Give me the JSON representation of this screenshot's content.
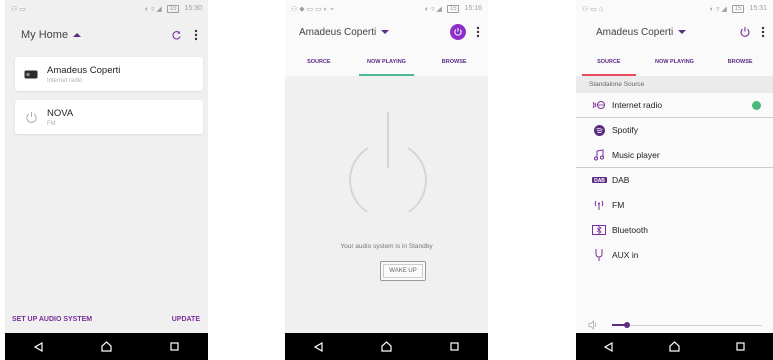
{
  "status_bar": {
    "p1_time": "15:30",
    "p2_time": "15:16",
    "p3_time": "15:31",
    "battery": "15"
  },
  "home": {
    "title": "My Home",
    "devices": [
      {
        "name": "Amadeus Coperti",
        "subtitle": "Internet radio"
      },
      {
        "name": "NOVA",
        "subtitle": "FM"
      }
    ],
    "setup_label": "SET UP AUDIO SYSTEM",
    "update_label": "UPDATE"
  },
  "now_playing": {
    "title": "Amadeus Coperti",
    "tabs": [
      "SOURCE",
      "NOW PLAYING",
      "BROWSE"
    ],
    "active_tab": "NOW PLAYING",
    "standby_text": "Your audio system is in Standby",
    "wake_label": "WAKE UP"
  },
  "source": {
    "title": "Amadeus Coperti",
    "tabs": [
      "SOURCE",
      "NOW PLAYING",
      "BROWSE"
    ],
    "active_tab": "SOURCE",
    "section_label": "Standalone Source",
    "items": [
      {
        "label": "Internet radio",
        "icon": "internet-radio-icon",
        "selected": true
      },
      {
        "label": "Spotify",
        "icon": "spotify-icon"
      },
      {
        "label": "Music player",
        "icon": "music-note-icon"
      },
      {
        "label": "DAB",
        "icon": "dab-icon"
      },
      {
        "label": "FM",
        "icon": "fm-antenna-icon"
      },
      {
        "label": "Bluetooth",
        "icon": "bluetooth-icon"
      },
      {
        "label": "AUX in",
        "icon": "aux-icon"
      }
    ],
    "volume_level": 0.1
  },
  "colors": {
    "brand_purple": "#5b2c83",
    "accent_purple": "#7a2e99",
    "now_playing_underline": "#4db89a",
    "source_underline": "#e84a5f",
    "check_green": "#4cb87a"
  }
}
